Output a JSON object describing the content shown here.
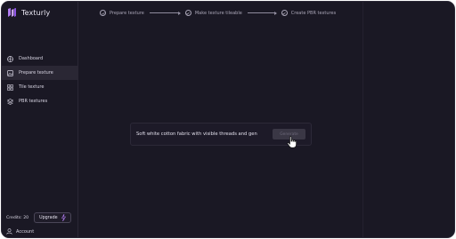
{
  "app": {
    "name": "Texturly"
  },
  "steps": [
    {
      "label": "Prepare texture"
    },
    {
      "label": "Make texture tileable"
    },
    {
      "label": "Create PBR textures"
    }
  ],
  "sidebar": {
    "items": [
      {
        "label": "Dashboard",
        "icon": "dashboard-icon",
        "active": false
      },
      {
        "label": "Prepare texture",
        "icon": "image-icon",
        "active": true
      },
      {
        "label": "Tile texture",
        "icon": "grid-icon",
        "active": false
      },
      {
        "label": "PBR textures",
        "icon": "layers-icon",
        "active": false
      }
    ],
    "credits_label": "Credits: 20",
    "upgrade_label": "Upgrade",
    "account_label": "Account"
  },
  "prompt": {
    "text": "Soft white cotton fabric with visible threads and gen",
    "generate_label": "Generate"
  },
  "colors": {
    "background": "#1a1824",
    "accent": "#b07cf0",
    "text": "#e3e0ec"
  }
}
